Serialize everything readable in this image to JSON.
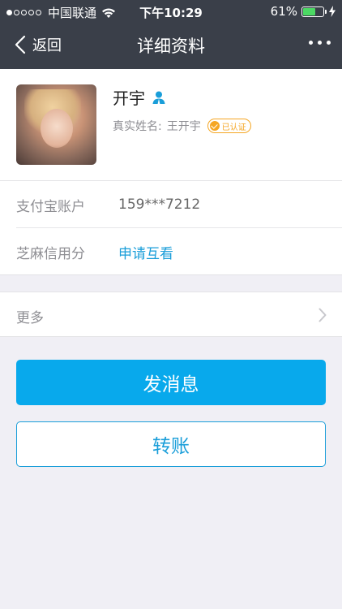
{
  "status_bar": {
    "carrier": "中国联通",
    "time": "下午10:29",
    "battery_percent": "61%",
    "battery_level": 0.61,
    "icons": [
      "signal-dots-icon",
      "wifi-icon",
      "battery-icon",
      "charging-bolt-icon"
    ]
  },
  "nav": {
    "back_label": "返回",
    "title": "详细资料"
  },
  "profile": {
    "name": "开宇",
    "real_name_label": "真实姓名:",
    "real_name": "王开宇",
    "verified_label": "已认证"
  },
  "info": [
    {
      "label": "支付宝账户",
      "value": "159***7212"
    },
    {
      "label": "芝麻信用分",
      "value": "申请互看"
    }
  ],
  "more": {
    "label": "更多"
  },
  "buttons": {
    "message": "发消息",
    "transfer": "转账"
  },
  "colors": {
    "nav_bg": "#3a3f49",
    "accent": "#08a9ec",
    "link": "#1a9ed9",
    "verified": "#f5a623",
    "battery": "#4cd964"
  }
}
